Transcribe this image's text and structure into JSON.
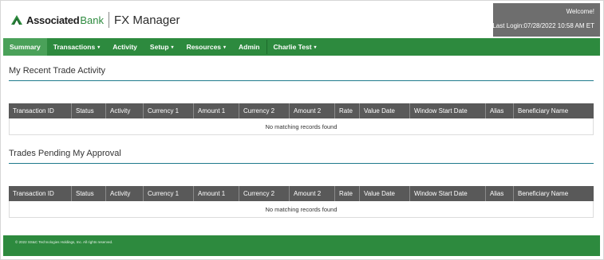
{
  "header": {
    "brand_name": "Associated",
    "brand_suffix": "Bank",
    "app_title": "FX Manager",
    "welcome": "Welcome!",
    "last_login": "Last Login:07/28/2022 10:58 AM ET"
  },
  "nav": {
    "items": [
      {
        "label": "Summary",
        "active": true,
        "dropdown": false
      },
      {
        "label": "Transactions",
        "dropdown": true
      },
      {
        "label": "Activity",
        "dropdown": false
      },
      {
        "label": "Setup",
        "dropdown": true
      },
      {
        "label": "Resources",
        "dropdown": true
      },
      {
        "label": "Admin",
        "dropdown": false
      },
      {
        "label": "Charlie Test",
        "dropdown": true
      }
    ],
    "caret": "▾"
  },
  "recent": {
    "title": "My Recent Trade Activity",
    "columns": [
      "Transaction ID",
      "Status",
      "Activity",
      "Currency 1",
      "Amount 1",
      "Currency 2",
      "Amount 2",
      "Rate",
      "Value Date",
      "Window Start Date",
      "Alias",
      "Beneficiary Name"
    ],
    "empty_text": "No matching records found"
  },
  "pending": {
    "title": "Trades Pending My Approval",
    "columns": [
      "Transaction ID",
      "Status",
      "Activity",
      "Currency 1",
      "Amount 1",
      "Currency 2",
      "Amount 2",
      "Rate",
      "Value Date",
      "Window Start Date",
      "Alias",
      "Beneficiary Name"
    ],
    "empty_text": "No matching records found"
  },
  "footer": {
    "copyright": "© 2022 SS&C Technologies Holdings, Inc. All rights reserved."
  },
  "colors": {
    "brand_green": "#2d8a3e",
    "active_tab": "#4aa159",
    "header_gray": "#6e6e6e",
    "table_header": "#595959",
    "rule": "#1f7a8c"
  }
}
